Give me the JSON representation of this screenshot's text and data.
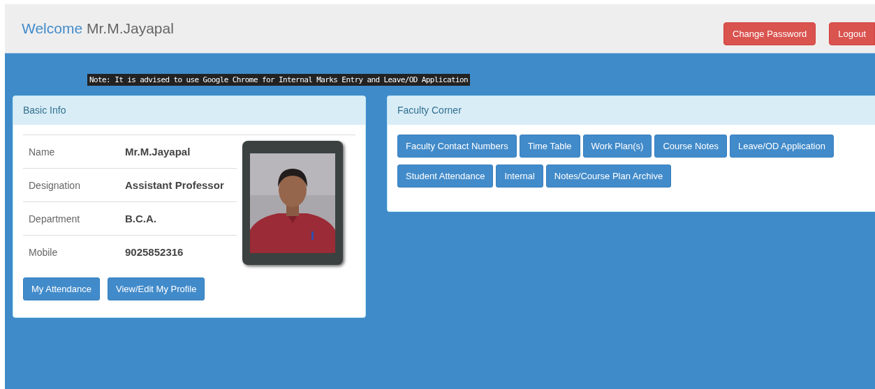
{
  "header": {
    "welcome": "Welcome",
    "user": "Mr.M.Jayapal",
    "buttons": [
      "Change Password",
      "Logout"
    ]
  },
  "note": "Note: It is advised to use Google Chrome for Internal Marks Entry and Leave/OD Application",
  "basic_info": {
    "title": "Basic Info",
    "fields": [
      {
        "label": "Name",
        "value": "Mr.M.Jayapal"
      },
      {
        "label": "Designation",
        "value": "Assistant Professor"
      },
      {
        "label": "Department",
        "value": "B.C.A."
      },
      {
        "label": "Mobile",
        "value": "9025852316"
      }
    ],
    "photo": {
      "kind": "picture"
    },
    "buttons": [
      "My Attendance",
      "View/Edit My Profile"
    ]
  },
  "faculty_corner": {
    "title": "Faculty Corner",
    "buttons": [
      [
        "Faculty Contact Numbers",
        "Time Table",
        "Work Plan(s)",
        "Course Notes",
        "Leave/OD Application"
      ],
      [
        "Student Attendance",
        "Internal",
        "Notes/Course Plan Archive"
      ]
    ]
  }
}
